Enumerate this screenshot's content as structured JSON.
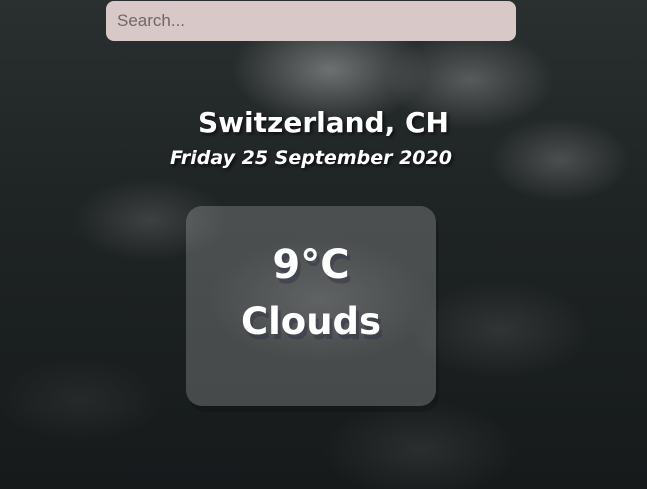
{
  "search": {
    "placeholder": "Search...",
    "value": ""
  },
  "location": {
    "name": "Switzerland, CH",
    "date": "Friday 25 September 2020"
  },
  "weather": {
    "temperature": "9°C",
    "condition": "Clouds"
  },
  "colors": {
    "search_bg": "#d9c8c8",
    "text": "#ffffff",
    "box_bg": "rgba(255,255,255,0.2)"
  }
}
